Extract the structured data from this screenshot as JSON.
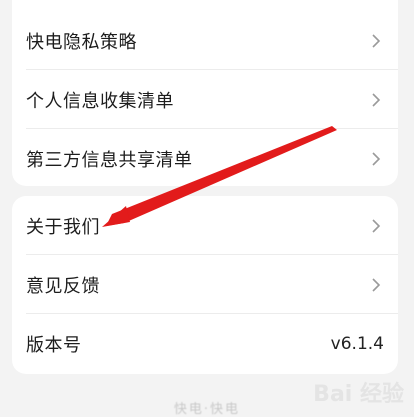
{
  "menu_top": {
    "items": [
      {
        "label": "快电隐私策略"
      },
      {
        "label": "个人信息收集清单"
      },
      {
        "label": "第三方信息共享清单"
      }
    ]
  },
  "menu_bottom": {
    "about_label": "关于我们",
    "feedback_label": "意见反馈",
    "version_label": "版本号",
    "version_value": "v6.1.4"
  },
  "footer": {
    "brand_text": "快电·快电"
  },
  "watermark_text": "Bai 经验",
  "colors": {
    "background": "#f3f3f3",
    "card": "#ffffff",
    "annotation_arrow": "#e21b1b"
  },
  "icons": {
    "row_chevron": "chevron-right-icon",
    "annotation": "red-arrow-annotation"
  }
}
